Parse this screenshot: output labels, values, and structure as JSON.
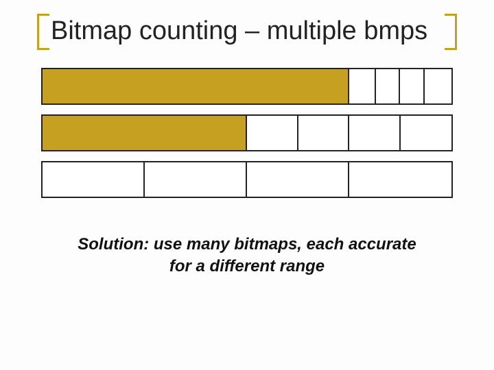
{
  "title": "Bitmap counting – multiple bmps",
  "solution_line1": "Solution: use many bitmaps, each accurate",
  "solution_line2": "for a different range",
  "chart_data": {
    "type": "table",
    "description": "Three horizontal bars of equal width, each divided into segments by vertical borders. A leading portion of each bar is filled gold; remaining segments are white. Each bar represents a bitmap accurate over a different coarseness/range.",
    "bars": [
      {
        "segments_pct": [
          75,
          6.5,
          6,
          6,
          6.5
        ],
        "filled_segments": 1
      },
      {
        "segments_pct": [
          50,
          12.5,
          12.5,
          12.5,
          12.5
        ],
        "filled_segments": 1
      },
      {
        "segments_pct": [
          25,
          25,
          25,
          25
        ],
        "filled_segments": 0
      }
    ],
    "fill_color": "#c5a021",
    "empty_color": "#ffffff",
    "border_color": "#222222"
  }
}
